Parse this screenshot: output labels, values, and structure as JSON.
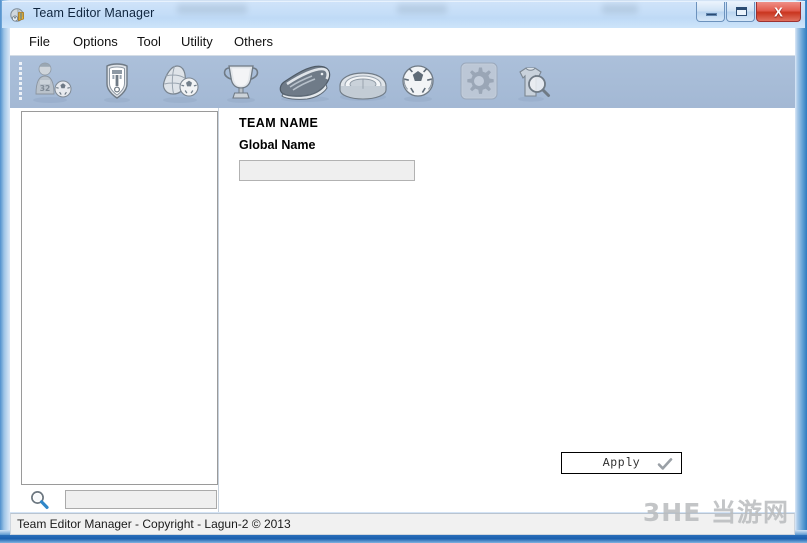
{
  "window": {
    "title": "Team Editor Manager",
    "app_icon": "globe-shield-icon",
    "controls": {
      "minimize_label": "",
      "maximize_label": "",
      "close_label": "X"
    }
  },
  "menubar": {
    "items": [
      {
        "label": "File",
        "name": "menu-file"
      },
      {
        "label": "Options",
        "name": "menu-options"
      },
      {
        "label": "Tool",
        "name": "menu-tool"
      },
      {
        "label": "Utility",
        "name": "menu-utility"
      },
      {
        "label": "Others",
        "name": "menu-others"
      }
    ]
  },
  "toolbar": {
    "grip": "drag-grip",
    "buttons": [
      {
        "icon": "player-ball-icon",
        "label": "Players"
      },
      {
        "icon": "club-badge-icon",
        "label": "Teams"
      },
      {
        "icon": "globe-ball-icon",
        "label": "Leagues"
      },
      {
        "icon": "trophy-icon",
        "label": "Competitions"
      },
      {
        "icon": "boot-icon",
        "label": "Boots"
      },
      {
        "icon": "stadium-icon",
        "label": "Stadiums"
      },
      {
        "icon": "soccer-ball-icon",
        "label": "Balls"
      },
      {
        "icon": "gear-icon",
        "label": "Settings"
      },
      {
        "icon": "kit-search-icon",
        "label": "Search"
      }
    ],
    "selected_index": 7
  },
  "sidebar": {
    "items": [],
    "search": {
      "icon": "magnifier-icon",
      "value": "",
      "placeholder": ""
    }
  },
  "content": {
    "heading": "TEAM NAME",
    "global_name": {
      "label": "Global Name",
      "value": "",
      "placeholder": ""
    },
    "apply": {
      "label": "Apply",
      "icon": "checkmark-icon"
    }
  },
  "statusbar": {
    "text": "Team Editor Manager - Copyright - Lagun-2 © 2013"
  },
  "watermark": {
    "text": "3HE 当游网"
  },
  "colors": {
    "titlebar": "#c4ddf7",
    "toolbar": "#a7bcd7",
    "frame_blue": "#2f7bc0",
    "close_red": "#c9351f",
    "input_bg": "#efefef",
    "statusbar_bg": "#f1f1f1"
  }
}
